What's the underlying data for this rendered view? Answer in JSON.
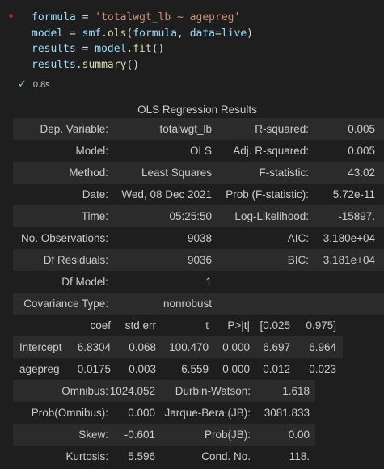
{
  "cell": {
    "code_lines": [
      {
        "parts": [
          {
            "t": "formula",
            "c": "lid"
          },
          {
            "t": " = ",
            "c": ""
          },
          {
            "t": "'totalwgt_lb ~ agepreg'",
            "c": "str"
          }
        ]
      },
      {
        "parts": [
          {
            "t": "model",
            "c": "lid"
          },
          {
            "t": " = ",
            "c": ""
          },
          {
            "t": "smf",
            "c": "lid"
          },
          {
            "t": ".",
            "c": ""
          },
          {
            "t": "ols",
            "c": "fn"
          },
          {
            "t": "(",
            "c": ""
          },
          {
            "t": "formula",
            "c": "lid"
          },
          {
            "t": ", ",
            "c": ""
          },
          {
            "t": "data",
            "c": "lid"
          },
          {
            "t": "=",
            "c": ""
          },
          {
            "t": "live",
            "c": "lid"
          },
          {
            "t": ")",
            "c": ""
          }
        ]
      },
      {
        "parts": [
          {
            "t": "results",
            "c": "lid"
          },
          {
            "t": " = ",
            "c": ""
          },
          {
            "t": "model",
            "c": "lid"
          },
          {
            "t": ".",
            "c": ""
          },
          {
            "t": "fit",
            "c": "fn"
          },
          {
            "t": "()",
            "c": ""
          }
        ]
      },
      {
        "parts": [
          {
            "t": "results",
            "c": "lid"
          },
          {
            "t": ".",
            "c": ""
          },
          {
            "t": "summary",
            "c": "fn"
          },
          {
            "t": "()",
            "c": ""
          }
        ]
      }
    ],
    "status_time": "0.8s"
  },
  "summary": {
    "title": "OLS Regression Results",
    "block1": [
      [
        "Dep. Variable:",
        "totalwgt_lb",
        "R-squared:",
        "0.005"
      ],
      [
        "Model:",
        "OLS",
        "Adj. R-squared:",
        "0.005"
      ],
      [
        "Method:",
        "Least Squares",
        "F-statistic:",
        "43.02"
      ],
      [
        "Date:",
        "Wed, 08 Dec 2021",
        "Prob (F-statistic):",
        "5.72e-11"
      ],
      [
        "Time:",
        "05:25:50",
        "Log-Likelihood:",
        "-15897."
      ],
      [
        "No. Observations:",
        "9038",
        "AIC:",
        "3.180e+04"
      ],
      [
        "Df Residuals:",
        "9036",
        "BIC:",
        "3.181e+04"
      ],
      [
        "Df Model:",
        "1",
        "",
        ""
      ],
      [
        "Covariance Type:",
        "nonrobust",
        "",
        ""
      ]
    ],
    "coef_header": [
      "",
      "coef",
      "std err",
      "t",
      "P>|t|",
      "[0.025",
      "0.975]"
    ],
    "coef_rows": [
      [
        "Intercept",
        "6.8304",
        "0.068",
        "100.470",
        "0.000",
        "6.697",
        "6.964"
      ],
      [
        "agepreg",
        "0.0175",
        "0.003",
        "6.559",
        "0.000",
        "0.012",
        "0.023"
      ]
    ],
    "block3": [
      [
        "Omnibus:",
        "1024.052",
        "Durbin-Watson:",
        "1.618"
      ],
      [
        "Prob(Omnibus):",
        "0.000",
        "Jarque-Bera (JB):",
        "3081.833"
      ],
      [
        "Skew:",
        "-0.601",
        "Prob(JB):",
        "0.00"
      ],
      [
        "Kurtosis:",
        "5.596",
        "Cond. No.",
        "118."
      ]
    ]
  }
}
